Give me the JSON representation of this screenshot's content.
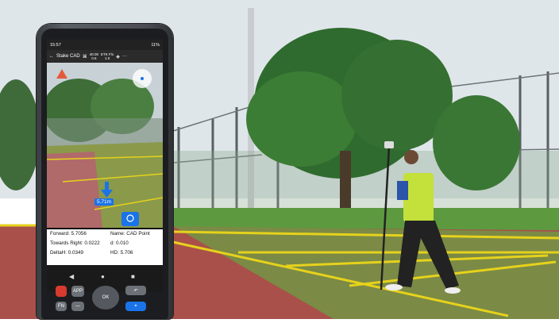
{
  "status_bar": {
    "time": "15:57",
    "battery": "11%"
  },
  "app_bar": {
    "title": "Stake CAD",
    "stat1_top": "40.00",
    "stat1_bottom": "0.6",
    "stat2_top": "ETK F/x",
    "stat2_bottom": "1.0",
    "more": "···"
  },
  "camera_overlay": {
    "distance_label": "5.71m"
  },
  "stake_info": {
    "forward": "Forward: 5.7056",
    "name": "Name: CAD Point",
    "towards_right": "Towards Right: 0.0222",
    "d": "d: 0.010",
    "deltah": "DeltaH: 0.0349",
    "hd": "HD: 5.706"
  },
  "keypad": {
    "ok_label": "OK",
    "app_label": "APP",
    "fn_label": "FN"
  },
  "colors": {
    "accent_blue": "#1a73e8",
    "field_line_yellow": "#e6d21c",
    "grass": "#4f8a3a",
    "pavement": "#a9504a"
  }
}
